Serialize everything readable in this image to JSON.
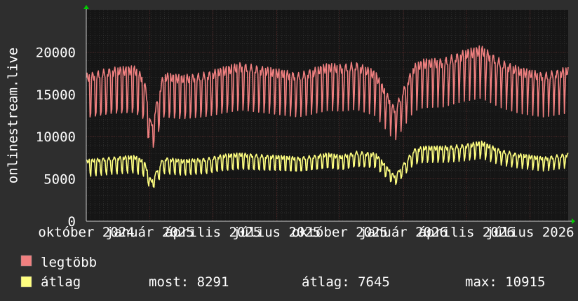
{
  "chart_data": {
    "type": "line",
    "ylabel": "onlinestream.live",
    "ylim": [
      0,
      25000
    ],
    "y_ticks": [
      0,
      5000,
      10000,
      15000,
      20000
    ],
    "y_tick_labels": [
      "0",
      "5000",
      "10000",
      "15000",
      "20000"
    ],
    "x_tick_labels": [
      "október 2024",
      "január 2025",
      "április 2025",
      "július 2025",
      "október 2025",
      "január 2026",
      "április 2026",
      "július 2026"
    ],
    "x_tick_positions": [
      0.0,
      0.132,
      0.263,
      0.395,
      0.526,
      0.658,
      0.789,
      0.921
    ],
    "grid": true,
    "series": [
      {
        "name": "legtöbb",
        "color": "#f08080",
        "anchors_x": [
          0.0,
          0.05,
          0.1,
          0.12,
          0.135,
          0.16,
          0.2,
          0.25,
          0.28,
          0.32,
          0.36,
          0.4,
          0.44,
          0.48,
          0.5,
          0.53,
          0.56,
          0.6,
          0.64,
          0.68,
          0.7,
          0.74,
          0.78,
          0.82,
          0.86,
          0.9,
          0.95,
          1.0
        ],
        "anchors_y": [
          17500,
          18200,
          18400,
          17200,
          11500,
          17600,
          17300,
          17700,
          18200,
          18800,
          18400,
          18000,
          17600,
          18300,
          18700,
          18600,
          18900,
          17800,
          13500,
          18600,
          19200,
          19300,
          20200,
          20800,
          19200,
          18200,
          17600,
          18300
        ],
        "low_fraction": 0.7
      },
      {
        "name": "átlag",
        "color": "#ffff80",
        "anchors_x": [
          0.0,
          0.05,
          0.1,
          0.12,
          0.135,
          0.16,
          0.2,
          0.25,
          0.28,
          0.32,
          0.36,
          0.4,
          0.44,
          0.48,
          0.5,
          0.53,
          0.56,
          0.6,
          0.64,
          0.68,
          0.7,
          0.74,
          0.78,
          0.82,
          0.86,
          0.9,
          0.95,
          1.0
        ],
        "anchors_y": [
          7300,
          7600,
          7800,
          7200,
          4800,
          7600,
          7300,
          7500,
          7900,
          8100,
          7900,
          7800,
          7600,
          7900,
          8100,
          7800,
          8300,
          8100,
          5400,
          8600,
          8900,
          8900,
          9100,
          9500,
          8500,
          8000,
          7600,
          8100
        ],
        "low_fraction": 0.78
      }
    ]
  },
  "legend": [
    {
      "label": "legtöbb",
      "color": "#f08080"
    },
    {
      "label": "átlag",
      "color": "#ffff80"
    }
  ],
  "stats": {
    "most": "most: 8291",
    "atlag": "átlag: 7645",
    "max": "max: 10915"
  }
}
